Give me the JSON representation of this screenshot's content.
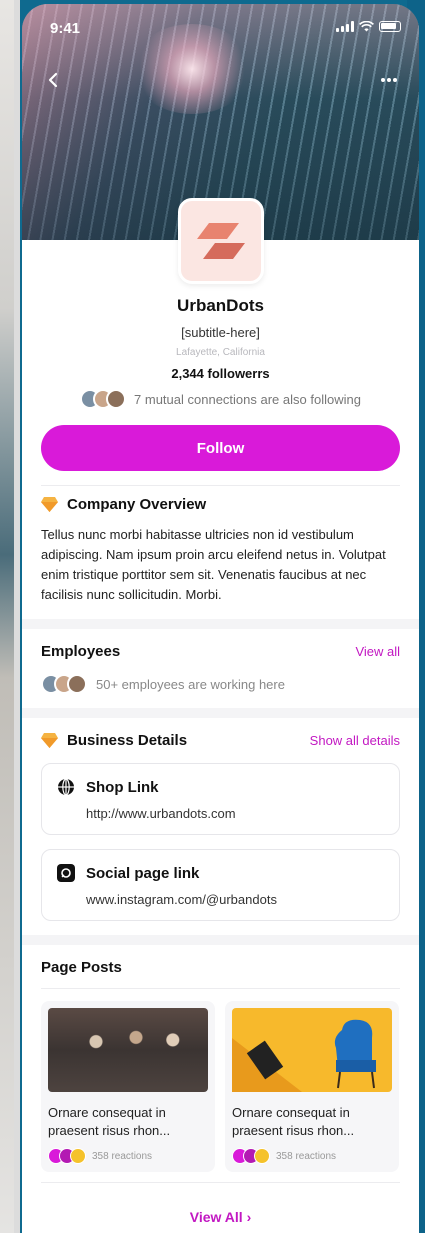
{
  "status_bar": {
    "time": "9:41"
  },
  "header": {
    "back_icon": "chevron-left-icon",
    "more_icon": "more-horizontal-icon"
  },
  "profile": {
    "name": "UrbanDots",
    "subtitle": "[subtitle-here]",
    "location": "Lafayette, California",
    "followers": "2,344 followerrs",
    "mutual_text": "7 mutual connections are also following",
    "follow_label": "Follow"
  },
  "overview": {
    "title": "Company Overview",
    "body": "Tellus nunc morbi habitasse ultricies non id vestibulum adipiscing. Nam ipsum proin arcu eleifend netus in. Volutpat enim tristique porttitor sem sit. Venenatis faucibus at nec facilisis nunc sollicitudin. Morbi."
  },
  "employees": {
    "title": "Employees",
    "view_all": "View all",
    "text": "50+ employees are working here"
  },
  "business": {
    "title": "Business Details",
    "show_all": "Show all details",
    "items": [
      {
        "title": "Shop Link",
        "value": "http://www.urbandots.com",
        "icon": "globe-icon"
      },
      {
        "title": "Social page link",
        "value": "www.instagram.com/@urbandots",
        "icon": "instagram-icon"
      }
    ]
  },
  "posts": {
    "title": "Page Posts",
    "items": [
      {
        "caption": "Ornare consequat in praesent risus rhon...",
        "reactions": "358 reactions"
      },
      {
        "caption": "Ornare consequat in praesent risus rhon...",
        "reactions": "358 reactions"
      }
    ],
    "view_all": "View All"
  },
  "colors": {
    "accent": "#d91ad9",
    "link": "#c218c2",
    "logo_bg": "#fbe6e2",
    "logo_mark": "#e07a68"
  }
}
